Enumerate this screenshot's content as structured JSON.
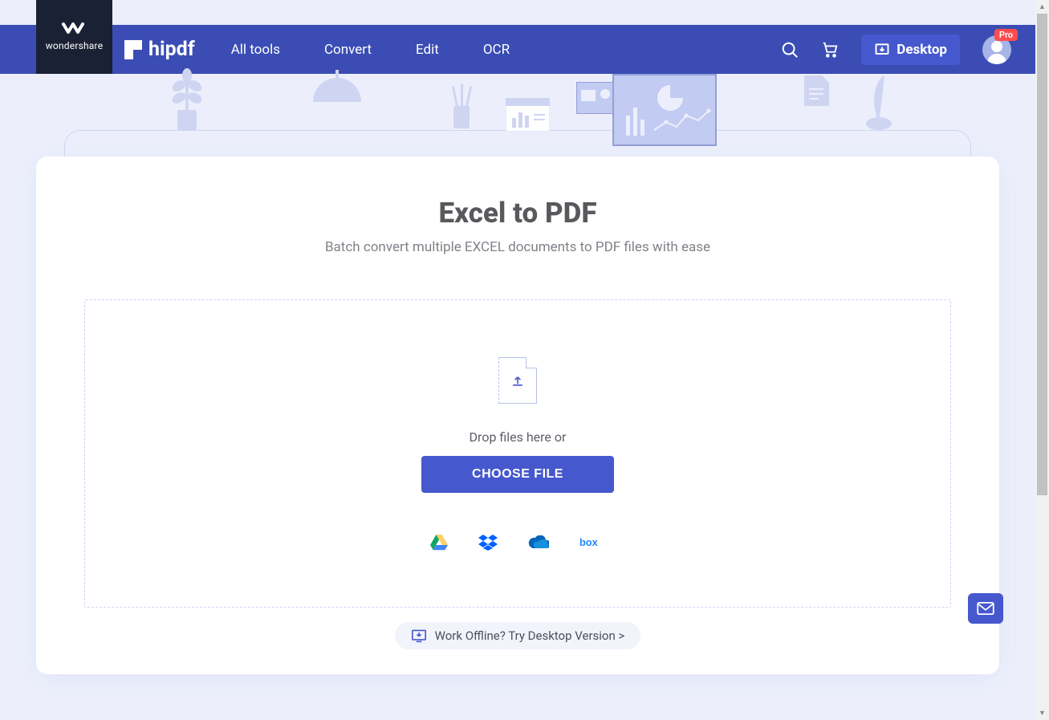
{
  "brand": {
    "parent": "wondershare",
    "product": "hipdf"
  },
  "nav": {
    "links": [
      "All tools",
      "Convert",
      "Edit",
      "OCR"
    ],
    "desktop_label": "Desktop",
    "pro_badge": "Pro"
  },
  "page": {
    "title": "Excel to PDF",
    "subtitle": "Batch convert multiple EXCEL documents to PDF files with ease"
  },
  "dropzone": {
    "hint": "Drop files here or",
    "button": "CHOOSE FILE"
  },
  "cloud_sources": [
    "google-drive",
    "dropbox",
    "onedrive",
    "box"
  ],
  "offline_pill": "Work Offline? Try Desktop Version >"
}
